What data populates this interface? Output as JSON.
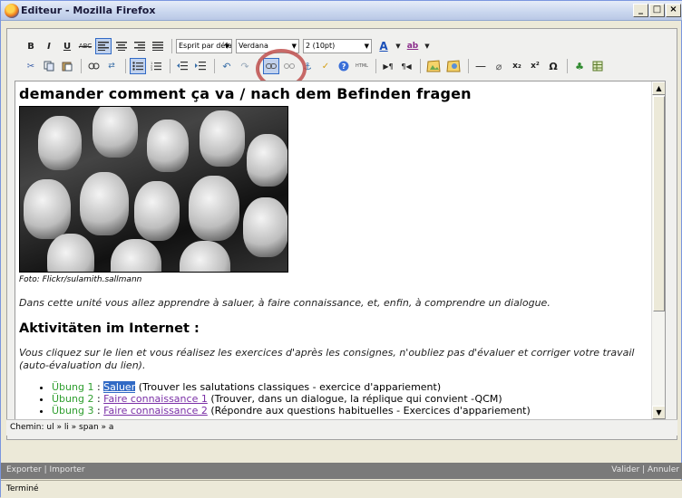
{
  "window": {
    "title": "Editeur - Mozilla Firefox",
    "min": "_",
    "max": "□",
    "close": "×"
  },
  "toolbar": {
    "bold": "B",
    "italic": "I",
    "underline": "U",
    "strike": "ABC",
    "font_family": "Esprit par défa",
    "font_name": "Verdana",
    "font_size": "2 (10pt)",
    "font_color_icon": "A",
    "highlight_icon": "ab"
  },
  "content": {
    "heading": "demander comment ça va / nach dem Befinden fragen",
    "caption": "Foto: Flickr/sulamith.sallmann",
    "intro": "Dans cette unité vous allez apprendre à saluer, à faire connaissance, et, enfin, à comprendre un dialogue.",
    "section_heading": "Aktivitäten im Internet :",
    "instructions": "Vous cliquez sur le lien et vous réalisez les exercices d'après les consignes, n'oubliez pas d'évaluer et corriger votre travail (auto-évaluation du lien).",
    "exercises": [
      {
        "num": "Übung 1",
        "sep": " : ",
        "link": "Saluer",
        "desc": " (Trouver les salutations classiques - exercice d'appariement)"
      },
      {
        "num": "Übung 2",
        "sep": " : ",
        "link": "Faire connaissance 1",
        "desc": " (Trouver, dans un dialogue, la réplique qui convient -QCM)"
      },
      {
        "num": "Übung 3",
        "sep": " : ",
        "link": "Faire connaissance 2",
        "desc": " (Répondre aux questions habituelles - Exercices d'appariement)"
      }
    ]
  },
  "path": "Chemin: ul » li » span » a",
  "bottom_bar": {
    "export": "Exporter",
    "import": "Importer",
    "validate": "Valider",
    "cancel": "Annuler"
  },
  "status": "Terminé",
  "colors": {
    "highlight_circle": "#c0504d",
    "selection": "#316ac5",
    "link": "#7a2fa6",
    "exercise_label": "#2f9e2f"
  }
}
